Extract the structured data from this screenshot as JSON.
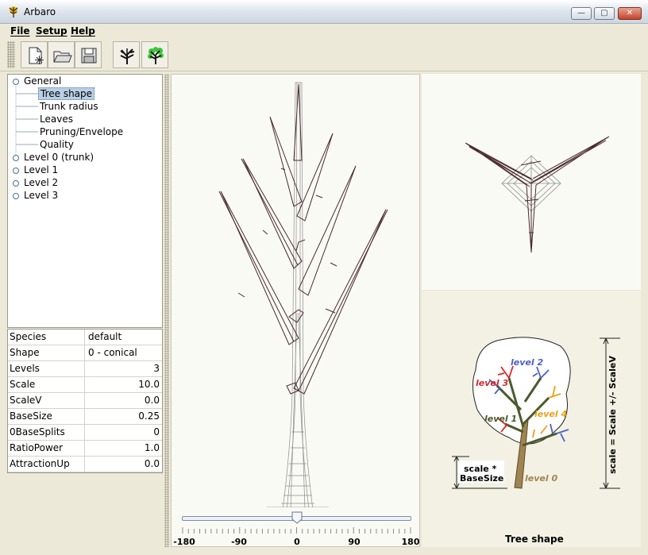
{
  "window": {
    "title": "Arbaro",
    "min_symbol": "—",
    "max_symbol": "▢",
    "close_symbol": "✕"
  },
  "menu": {
    "file": "File",
    "setup": "Setup",
    "help": "Help"
  },
  "toolbar": {
    "buttons": [
      {
        "name": "new-file-icon"
      },
      {
        "name": "open-folder-icon"
      },
      {
        "name": "save-disk-icon"
      },
      {
        "name": "render-tree-icon"
      },
      {
        "name": "render-tree-leaves-icon"
      }
    ]
  },
  "tree": {
    "general": "General",
    "children": [
      "Tree shape",
      "Trunk radius",
      "Leaves",
      "Pruning/Envelope",
      "Quality"
    ],
    "levels": [
      "Level 0 (trunk)",
      "Level 1",
      "Level 2",
      "Level 3"
    ]
  },
  "props": [
    {
      "key": "Species",
      "value": "default"
    },
    {
      "key": "Shape",
      "value": "0 - conical"
    },
    {
      "key": "Levels",
      "value": "3"
    },
    {
      "key": "Scale",
      "value": "10.0"
    },
    {
      "key": "ScaleV",
      "value": "0.0"
    },
    {
      "key": "BaseSize",
      "value": "0.25"
    },
    {
      "key": "0BaseSplits",
      "value": "0"
    },
    {
      "key": "RatioPower",
      "value": "1.0"
    },
    {
      "key": "AttractionUp",
      "value": "0.0"
    }
  ],
  "slider": {
    "labels": [
      "-180",
      "-90",
      "0",
      "90",
      "180"
    ],
    "value": 0,
    "min": -180,
    "max": 180
  },
  "info": {
    "level2": "level 2",
    "level3": "level 3",
    "level1": "level 1",
    "level4": "level 4",
    "level0": "level 0",
    "scale_basesize_1": "scale *",
    "scale_basesize_2": "BaseSize",
    "scale_formula": "scale = Scale +/- ScaleV",
    "caption": "Tree shape"
  },
  "colors": {
    "branch": "#4a2a2e",
    "level2": "#4b5fc9",
    "level3": "#d8282d",
    "level1": "#4b5a2c",
    "level4": "#e8a117",
    "level0": "#a08450"
  }
}
